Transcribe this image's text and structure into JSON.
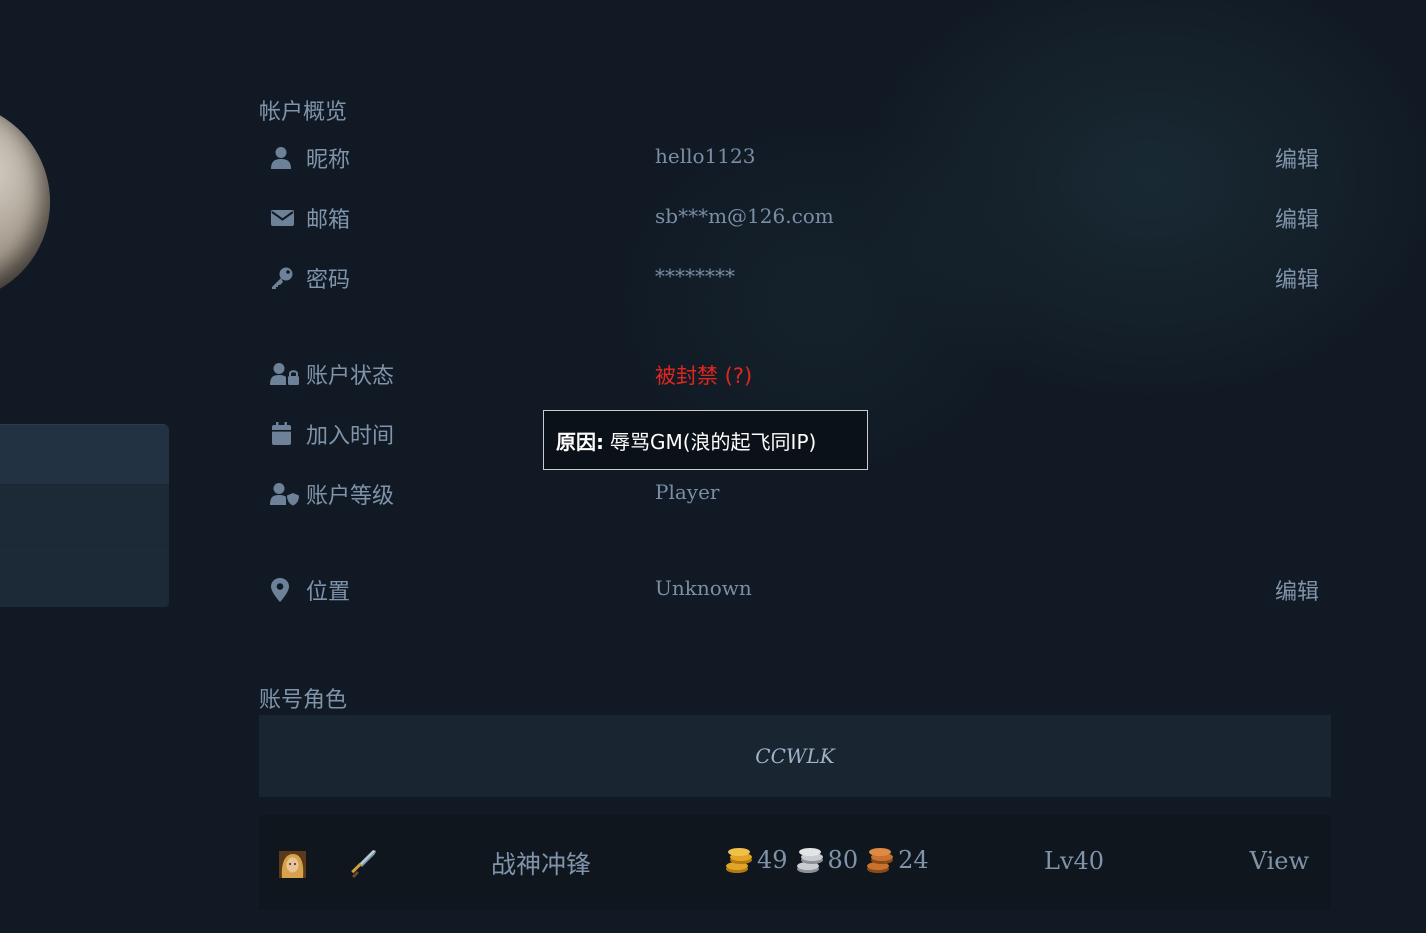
{
  "overview": {
    "title": "帐户概览",
    "rows": {
      "nickname": {
        "label": "昵称",
        "value": "hello1123",
        "edit": "编辑",
        "icon": "user-icon"
      },
      "email": {
        "label": "邮箱",
        "value": "sb***m@126.com",
        "edit": "编辑",
        "icon": "envelope-icon"
      },
      "password": {
        "label": "密码",
        "value": "********",
        "edit": "编辑",
        "icon": "key-icon"
      },
      "status": {
        "label": "账户状态",
        "value": "被封禁 (?)",
        "icon": "user-lock-icon",
        "color": "#e0261f"
      },
      "joined": {
        "label": "加入时间",
        "value": "",
        "icon": "calendar-icon"
      },
      "level": {
        "label": "账户等级",
        "value": "Player",
        "icon": "user-shield-icon"
      },
      "location": {
        "label": "位置",
        "value": "Unknown",
        "edit": "编辑",
        "icon": "map-marker-icon"
      }
    }
  },
  "tooltip": {
    "label": "原因:",
    "text": "辱骂GM(浪的起飞同IP)"
  },
  "characters": {
    "title": "账号角色",
    "realm": "CCWLK",
    "list": [
      {
        "name": "战神冲锋",
        "portrait_icon": "human-female-portrait-icon",
        "class_icon": "warrior-sword-icon",
        "gold": "49",
        "silver": "80",
        "copper": "24",
        "level": "Lv40",
        "view": "View"
      }
    ]
  },
  "colors": {
    "background": "#111a24",
    "text": "#7f93aa",
    "banned": "#e0261f",
    "gold": "#e0a526",
    "silver": "#c9ccd0",
    "copper": "#c8722e"
  }
}
